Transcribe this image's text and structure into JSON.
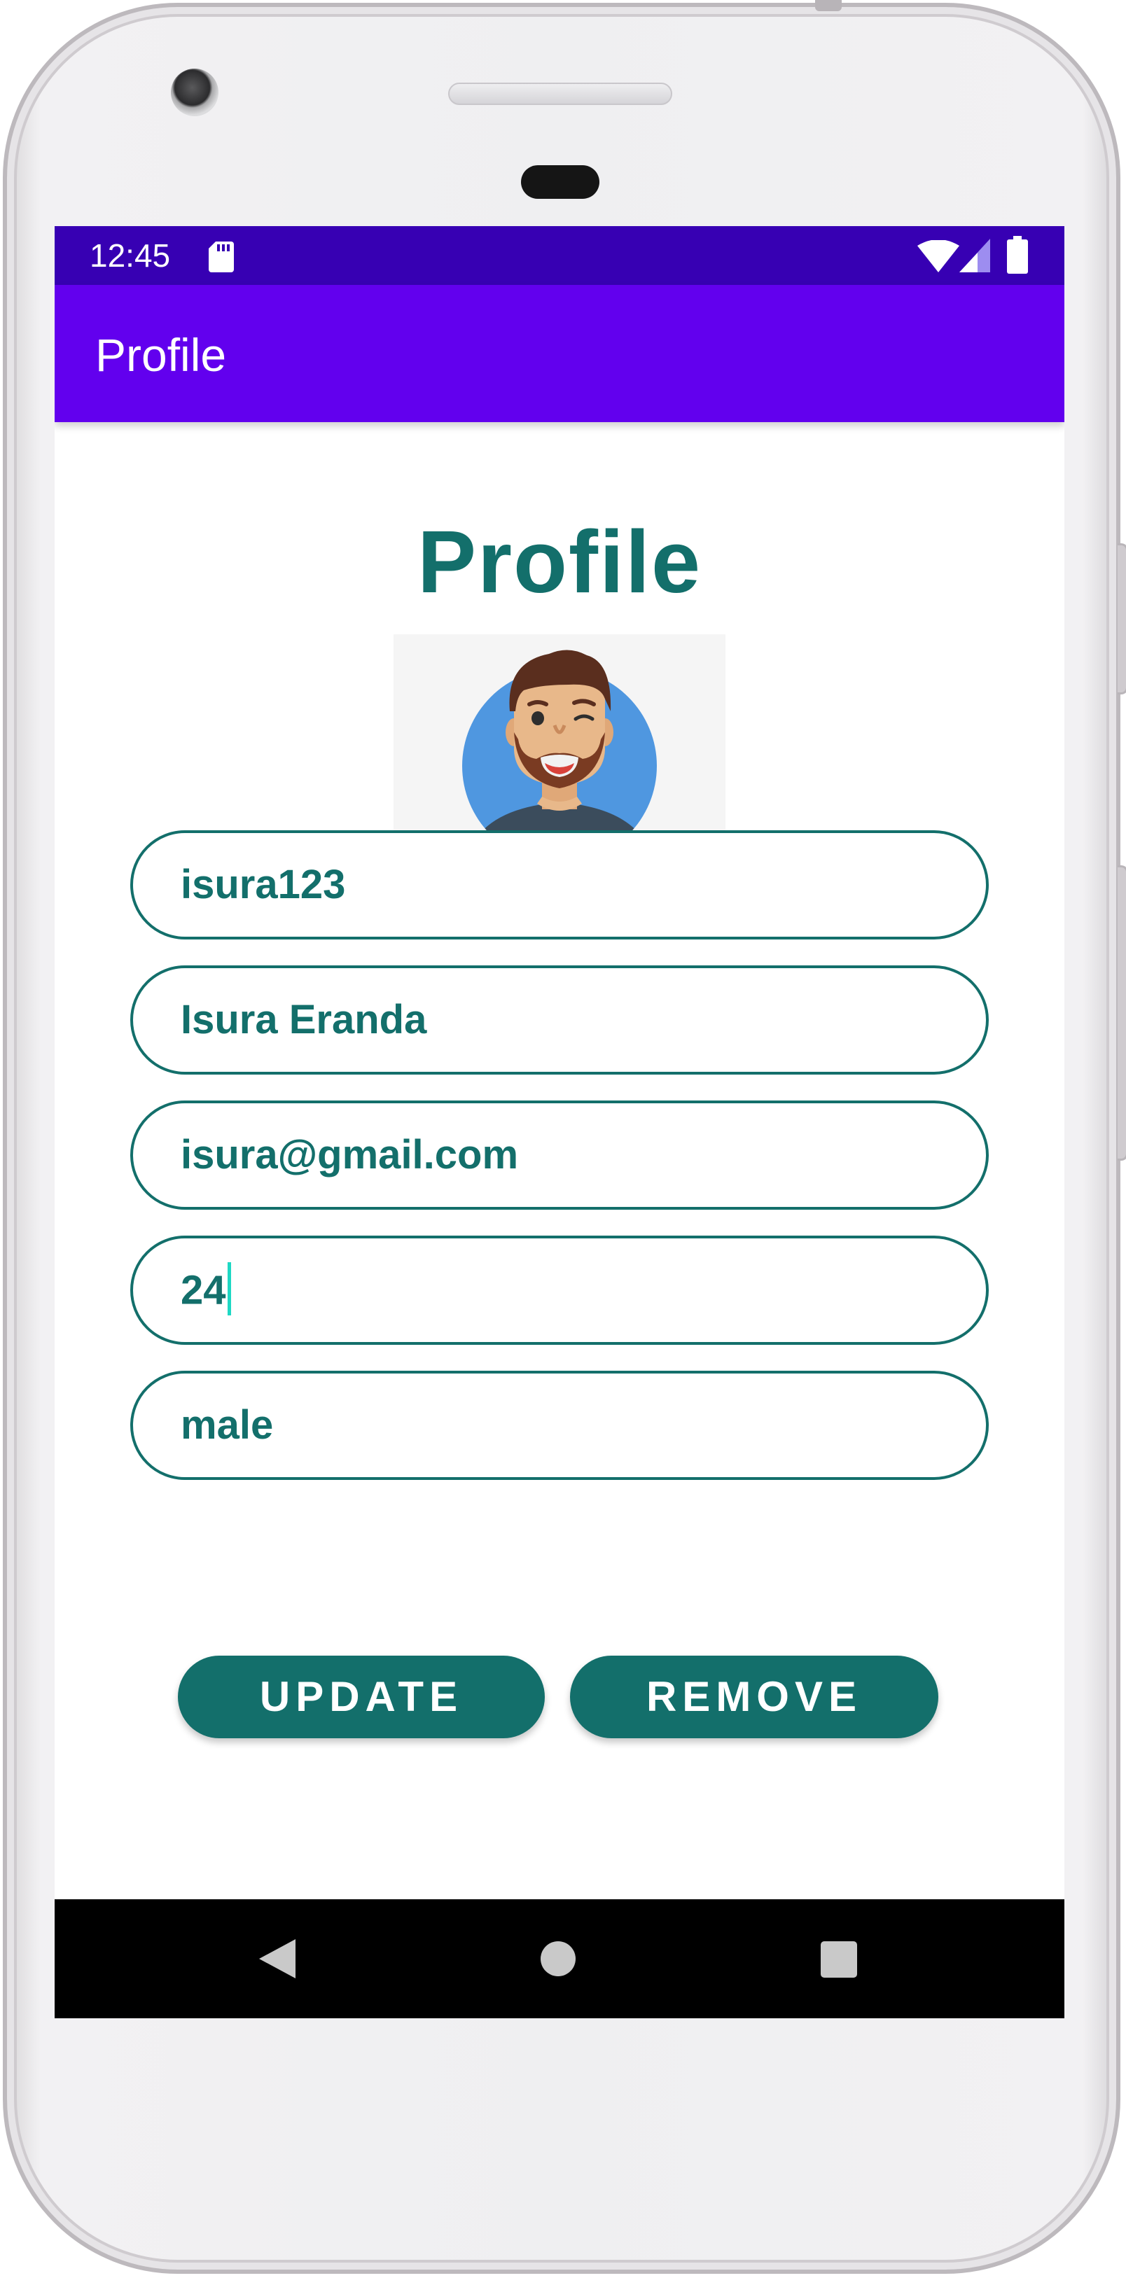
{
  "status_bar": {
    "time": "12:45",
    "icons": [
      "sd-card-icon",
      "wifi-icon",
      "signal-icon",
      "battery-icon"
    ]
  },
  "app_bar": {
    "title": "Profile"
  },
  "main": {
    "heading": "Profile",
    "avatar": "avatar-icon",
    "fields": [
      {
        "name": "username-field",
        "value": "isura123"
      },
      {
        "name": "full-name-field",
        "value": "Isura Eranda"
      },
      {
        "name": "email-field",
        "value": "isura@gmail.com"
      },
      {
        "name": "age-field",
        "value": "24"
      },
      {
        "name": "gender-field",
        "value": "male"
      }
    ],
    "buttons": {
      "update_label": "UPDATE",
      "remove_label": "REMOVE"
    }
  },
  "nav_bar": {
    "icons": [
      "back-icon",
      "home-icon",
      "recents-icon"
    ]
  },
  "colors": {
    "status_bar": "#3700B3",
    "app_bar": "#6200EE",
    "accent": "#136F6B",
    "cursor": "#1ED8C4"
  }
}
